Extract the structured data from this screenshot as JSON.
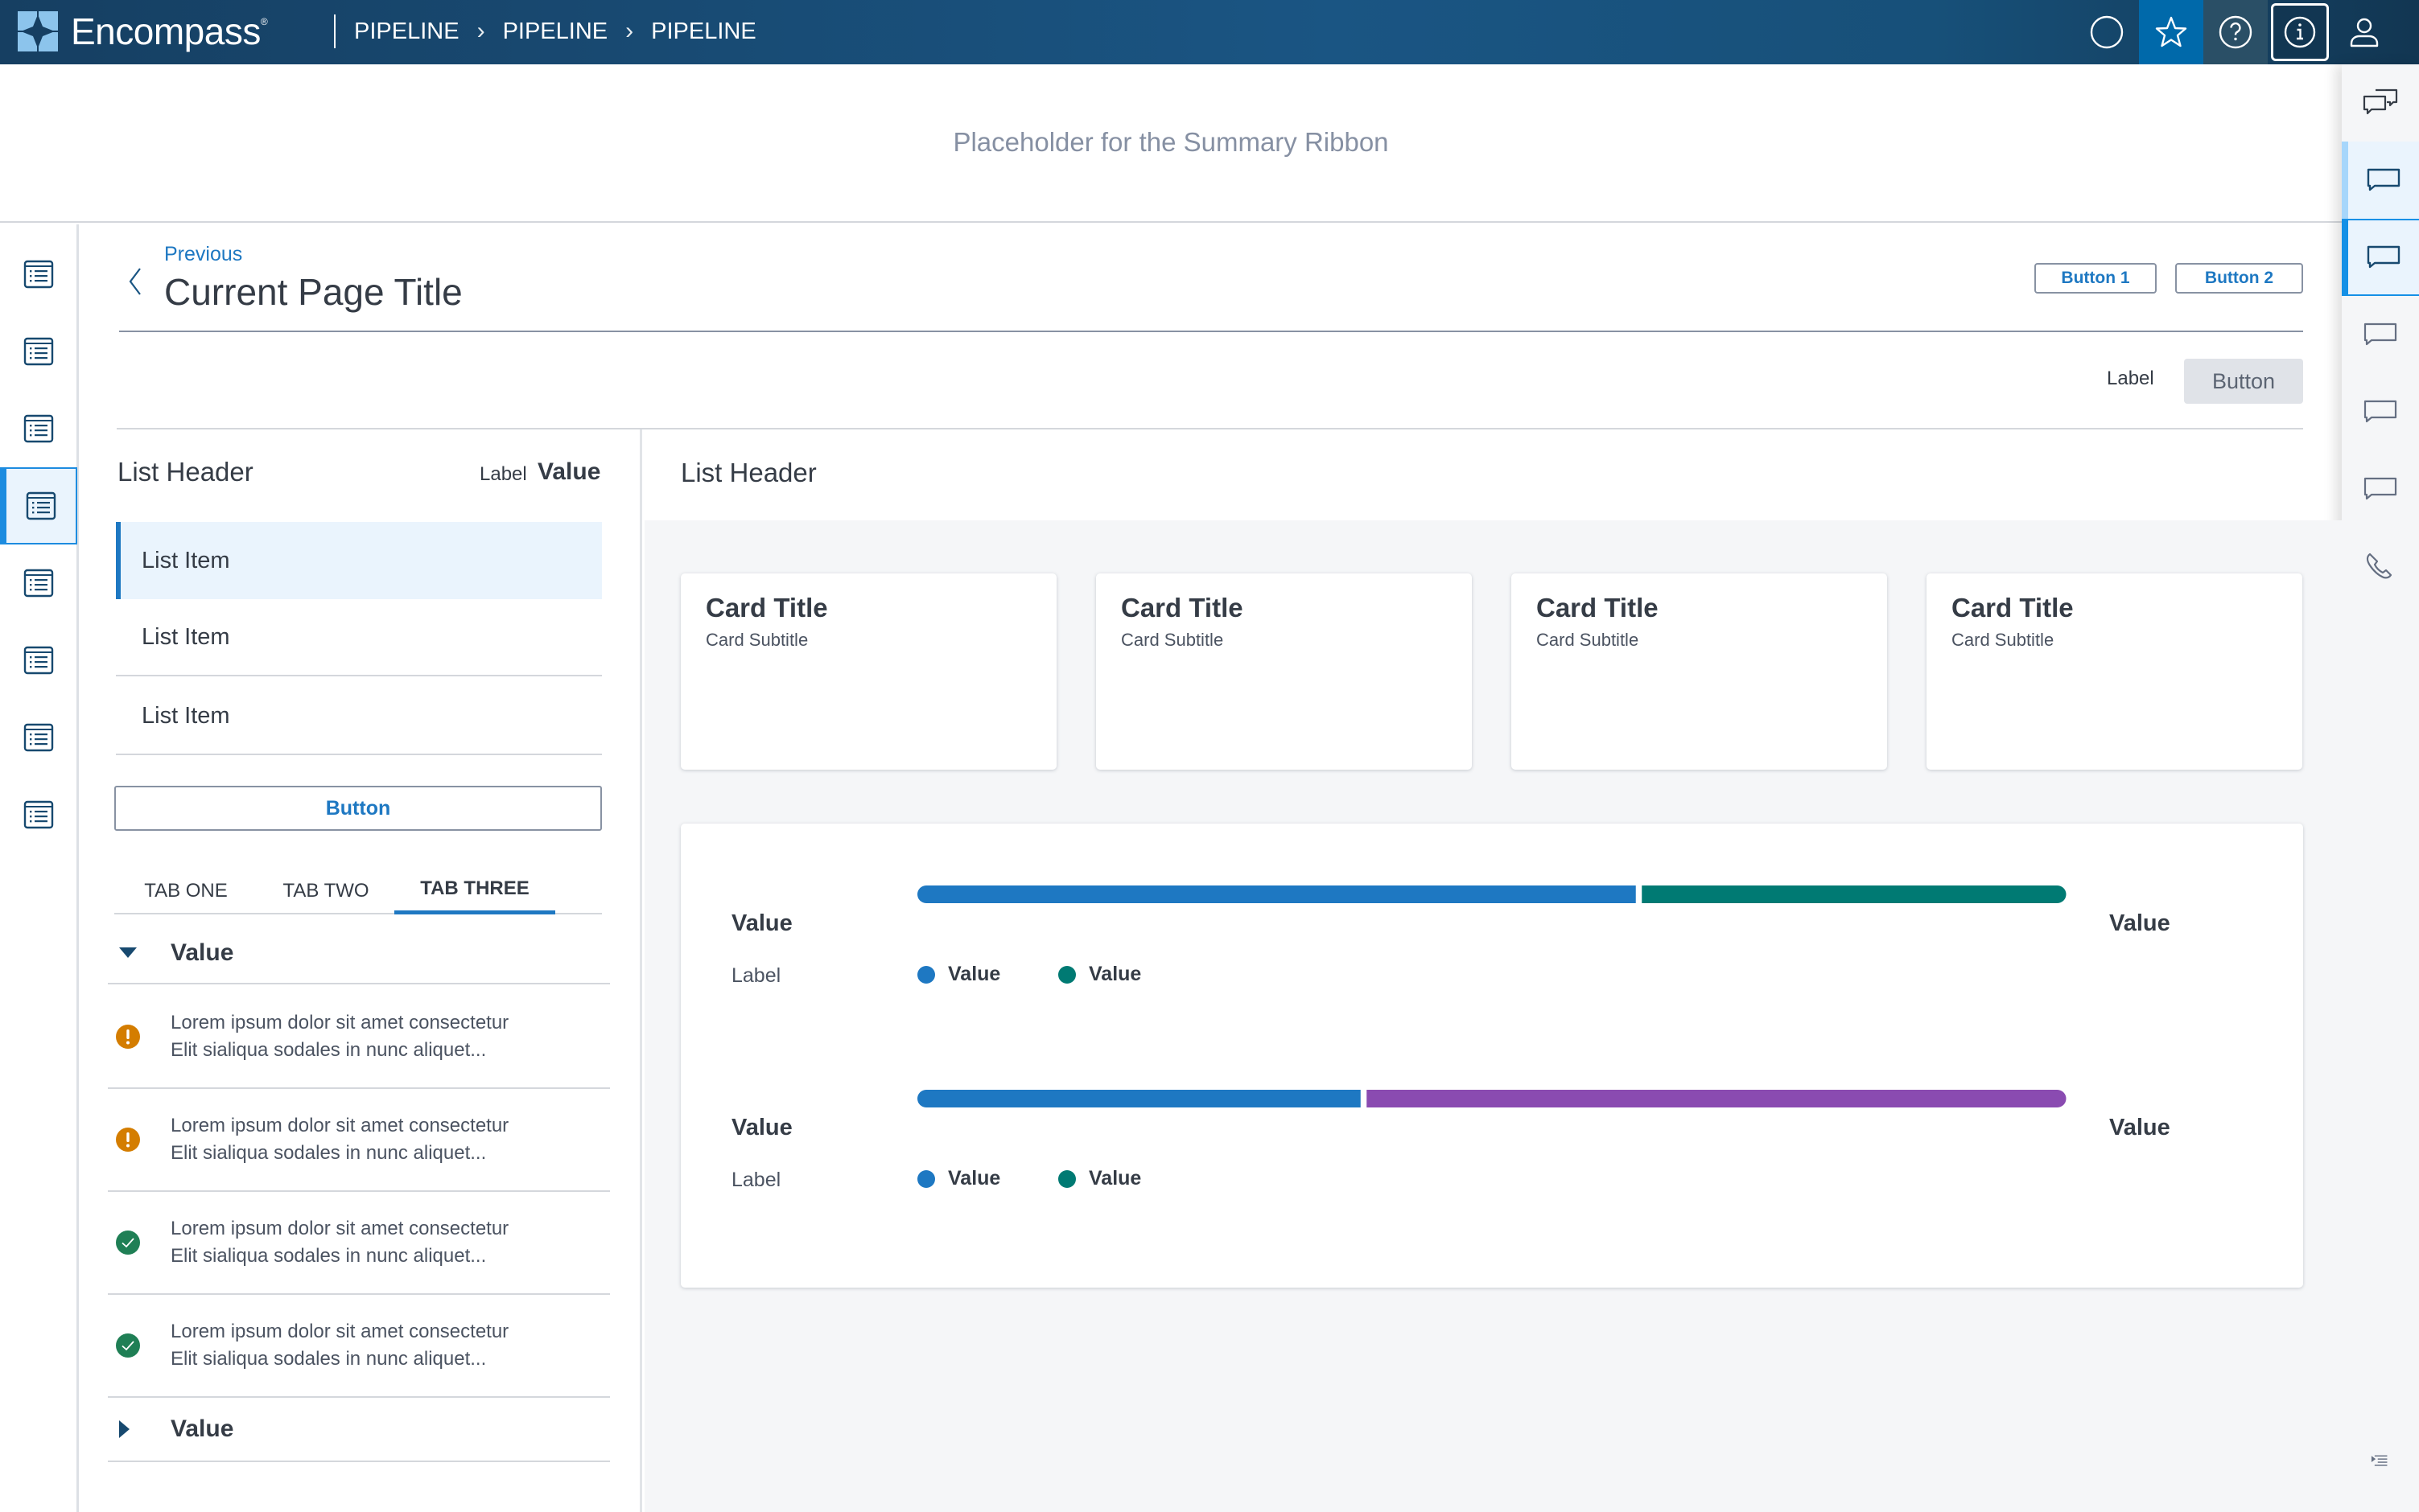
{
  "header": {
    "brand": "Encompass",
    "brand_mark": "®",
    "breadcrumbs": [
      "PIPELINE",
      "PIPELINE",
      "PIPELINE"
    ],
    "icons": [
      {
        "name": "circle-icon",
        "state": "default"
      },
      {
        "name": "star-icon",
        "state": "selected"
      },
      {
        "name": "help-icon",
        "state": "hover"
      },
      {
        "name": "info-icon",
        "state": "focused"
      },
      {
        "name": "user-icon",
        "state": "default"
      }
    ]
  },
  "ribbon": {
    "placeholder": "Placeholder for the Summary Ribbon"
  },
  "left_rail": {
    "icon": "list-window-icon",
    "item_count": 8,
    "active_index": 3
  },
  "right_rail": {
    "items": [
      {
        "icon": "conversations-icon",
        "state": "default"
      },
      {
        "icon": "comment-icon",
        "state": "hover"
      },
      {
        "icon": "comment-icon",
        "state": "active"
      },
      {
        "icon": "comment-icon",
        "state": "default"
      },
      {
        "icon": "comment-icon",
        "state": "default"
      },
      {
        "icon": "comment-icon",
        "state": "default"
      },
      {
        "icon": "phone-icon",
        "state": "default"
      }
    ],
    "footer_icon": "expand-panel-icon"
  },
  "page": {
    "previous": "Previous",
    "title": "Current Page Title",
    "button1": "Button 1",
    "button2": "Button 2",
    "toolbar_label": "Label",
    "toolbar_button": "Button"
  },
  "left_panel": {
    "header": "List Header",
    "label": "Label",
    "value": "Value",
    "items": [
      "List Item",
      "List Item",
      "List Item"
    ],
    "selected_index": 0,
    "button": "Button",
    "tabs": [
      "TAB ONE",
      "TAB TWO",
      "TAB THREE"
    ],
    "active_tab": 2,
    "accordion_open": {
      "label": "Value",
      "expanded": true
    },
    "messages": [
      {
        "status": "warning",
        "line1": "Lorem ipsum dolor sit amet consectetur",
        "line2": "Elit sialiqua sodales in nunc aliquet..."
      },
      {
        "status": "warning",
        "line1": "Lorem ipsum dolor sit amet consectetur",
        "line2": "Elit sialiqua sodales in nunc aliquet..."
      },
      {
        "status": "success",
        "line1": "Lorem ipsum dolor sit amet consectetur",
        "line2": "Elit sialiqua sodales in nunc aliquet..."
      },
      {
        "status": "success",
        "line1": "Lorem ipsum dolor sit amet consectetur",
        "line2": "Elit sialiqua sodales in nunc aliquet..."
      }
    ],
    "accordion_closed": {
      "label": "Value",
      "expanded": false
    }
  },
  "right_panel": {
    "header": "List Header",
    "cards": [
      {
        "title": "Card Title",
        "subtitle": "Card Subtitle"
      },
      {
        "title": "Card Title",
        "subtitle": "Card Subtitle"
      },
      {
        "title": "Card Title",
        "subtitle": "Card Subtitle"
      },
      {
        "title": "Card Title",
        "subtitle": "Card Subtitle"
      }
    ]
  },
  "colors": {
    "primary": "#1e78c2",
    "teal": "#007a73",
    "purple": "#8a4bb1",
    "warning": "#d47d00",
    "success": "#1f7f55",
    "header_dark": "#163f62"
  },
  "chart_data": {
    "type": "bar",
    "orientation": "horizontal-stacked",
    "rows": [
      {
        "value_label": "Value",
        "row_label": "Label",
        "end_label": "Value",
        "segments": [
          {
            "name": "Value",
            "fraction": 0.63,
            "color": "#1e78c2"
          },
          {
            "name": "Value",
            "fraction": 0.37,
            "color": "#007a73"
          }
        ],
        "legend": [
          {
            "label": "Value",
            "color": "#1e78c2"
          },
          {
            "label": "Value",
            "color": "#007a73"
          }
        ]
      },
      {
        "value_label": "Value",
        "row_label": "Label",
        "end_label": "Value",
        "segments": [
          {
            "name": "Value",
            "fraction": 0.39,
            "color": "#1e78c2"
          },
          {
            "name": "Value",
            "fraction": 0.61,
            "color": "#8a4bb1"
          }
        ],
        "legend": [
          {
            "label": "Value",
            "color": "#1e78c2"
          },
          {
            "label": "Value",
            "color": "#007a73"
          }
        ]
      }
    ]
  }
}
